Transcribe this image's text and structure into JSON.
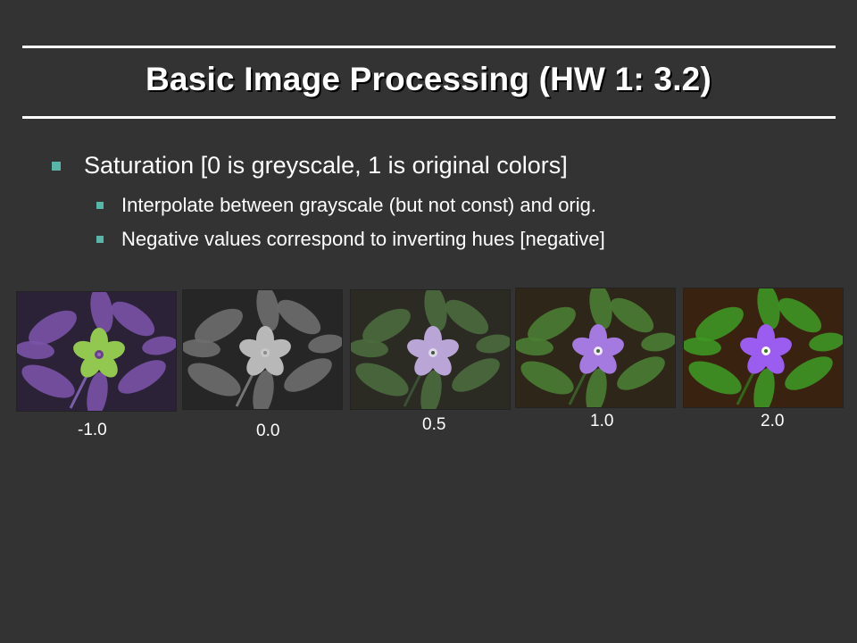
{
  "slide": {
    "title": "Basic Image Processing (HW 1: 3.2)",
    "bullet_main": "Saturation [0 is greyscale, 1 is original colors]",
    "sub_bullets": [
      "Interpolate between grayscale (but not const) and orig.",
      "Negative values correspond to inverting hues [negative]"
    ],
    "accent_color": "#58b6a8",
    "background_color": "#333333"
  },
  "images": [
    {
      "caption": "-1.0",
      "petal": "#8f6fc8",
      "petal_center": "#6b3e8a",
      "leaf": "#7a52a6",
      "flower": "#93c850",
      "bg": "#2b2238"
    },
    {
      "caption": "0.0",
      "petal": "#8a8a8a",
      "petal_center": "#c8c8c8",
      "leaf": "#6e6e6e",
      "flower": "#b8b8b8",
      "bg": "#262626"
    },
    {
      "caption": "0.5",
      "petal": "#405a38",
      "petal_center": "#e0d8ec",
      "leaf": "#4a6a3e",
      "flower": "#b9a6d6",
      "bg": "#2b2a23"
    },
    {
      "caption": "1.0",
      "petal": "#3c6a2e",
      "petal_center": "#f0e6ff",
      "leaf": "#4a7d33",
      "flower": "#a47ae0",
      "bg": "#2e2619"
    },
    {
      "caption": "2.0",
      "petal": "#2f7a1e",
      "petal_center": "#ffffff",
      "leaf": "#3d9624",
      "flower": "#9b5cf0",
      "bg": "#3a2210"
    }
  ]
}
